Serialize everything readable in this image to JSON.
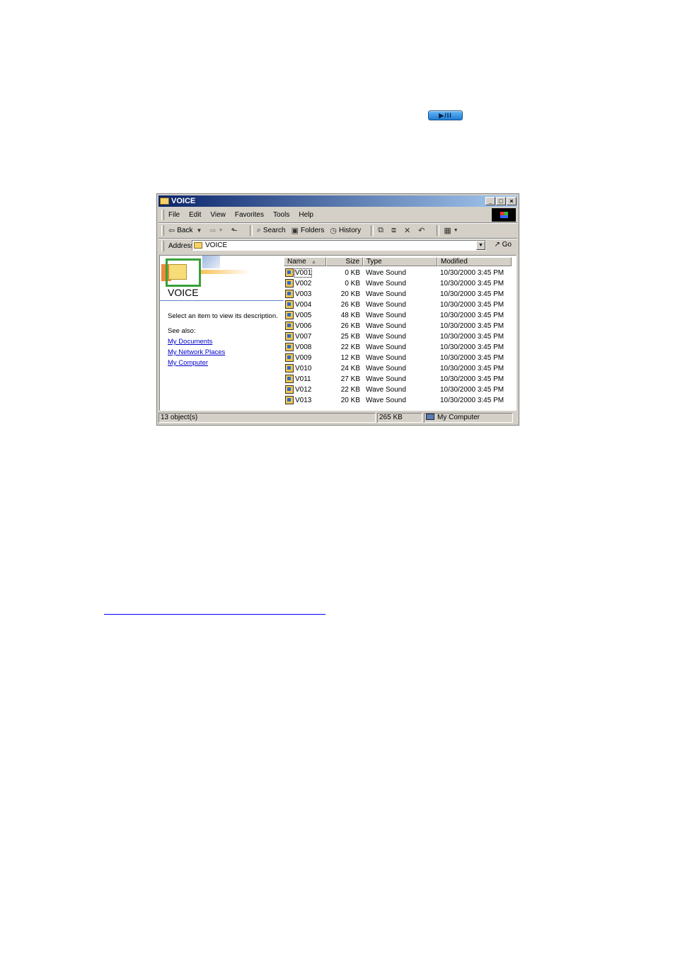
{
  "play_button": {
    "label": "▶/II"
  },
  "window": {
    "title": "VOICE",
    "controls": {
      "minimize": "_",
      "maximize": "□",
      "close": "×"
    },
    "menu": [
      "File",
      "Edit",
      "View",
      "Favorites",
      "Tools",
      "Help"
    ],
    "toolbar": {
      "back": "Back",
      "search": "Search",
      "folders": "Folders",
      "history": "History"
    },
    "address": {
      "label": "Address",
      "value": "VOICE",
      "go": "Go"
    },
    "left_pane": {
      "folder_title": "VOICE",
      "description": "Select an item to view its description.",
      "see_also": "See also:",
      "links": [
        "My Documents",
        "My Network Places",
        "My Computer"
      ]
    },
    "columns": {
      "name": "Name",
      "size": "Size",
      "type": "Type",
      "modified": "Modified"
    },
    "files": [
      {
        "name": "V001",
        "size": "0 KB",
        "type": "Wave Sound",
        "modified": "10/30/2000 3:45 PM"
      },
      {
        "name": "V002",
        "size": "0 KB",
        "type": "Wave Sound",
        "modified": "10/30/2000 3:45 PM"
      },
      {
        "name": "V003",
        "size": "20 KB",
        "type": "Wave Sound",
        "modified": "10/30/2000 3:45 PM"
      },
      {
        "name": "V004",
        "size": "26 KB",
        "type": "Wave Sound",
        "modified": "10/30/2000 3:45 PM"
      },
      {
        "name": "V005",
        "size": "48 KB",
        "type": "Wave Sound",
        "modified": "10/30/2000 3:45 PM"
      },
      {
        "name": "V006",
        "size": "26 KB",
        "type": "Wave Sound",
        "modified": "10/30/2000 3:45 PM"
      },
      {
        "name": "V007",
        "size": "25 KB",
        "type": "Wave Sound",
        "modified": "10/30/2000 3:45 PM"
      },
      {
        "name": "V008",
        "size": "22 KB",
        "type": "Wave Sound",
        "modified": "10/30/2000 3:45 PM"
      },
      {
        "name": "V009",
        "size": "12 KB",
        "type": "Wave Sound",
        "modified": "10/30/2000 3:45 PM"
      },
      {
        "name": "V010",
        "size": "24 KB",
        "type": "Wave Sound",
        "modified": "10/30/2000 3:45 PM"
      },
      {
        "name": "V011",
        "size": "27 KB",
        "type": "Wave Sound",
        "modified": "10/30/2000 3:45 PM"
      },
      {
        "name": "V012",
        "size": "22 KB",
        "type": "Wave Sound",
        "modified": "10/30/2000 3:45 PM"
      },
      {
        "name": "V013",
        "size": "20 KB",
        "type": "Wave Sound",
        "modified": "10/30/2000 3:45 PM"
      }
    ],
    "status": {
      "objects": "13 object(s)",
      "size": "265 KB",
      "location": "My Computer"
    }
  }
}
